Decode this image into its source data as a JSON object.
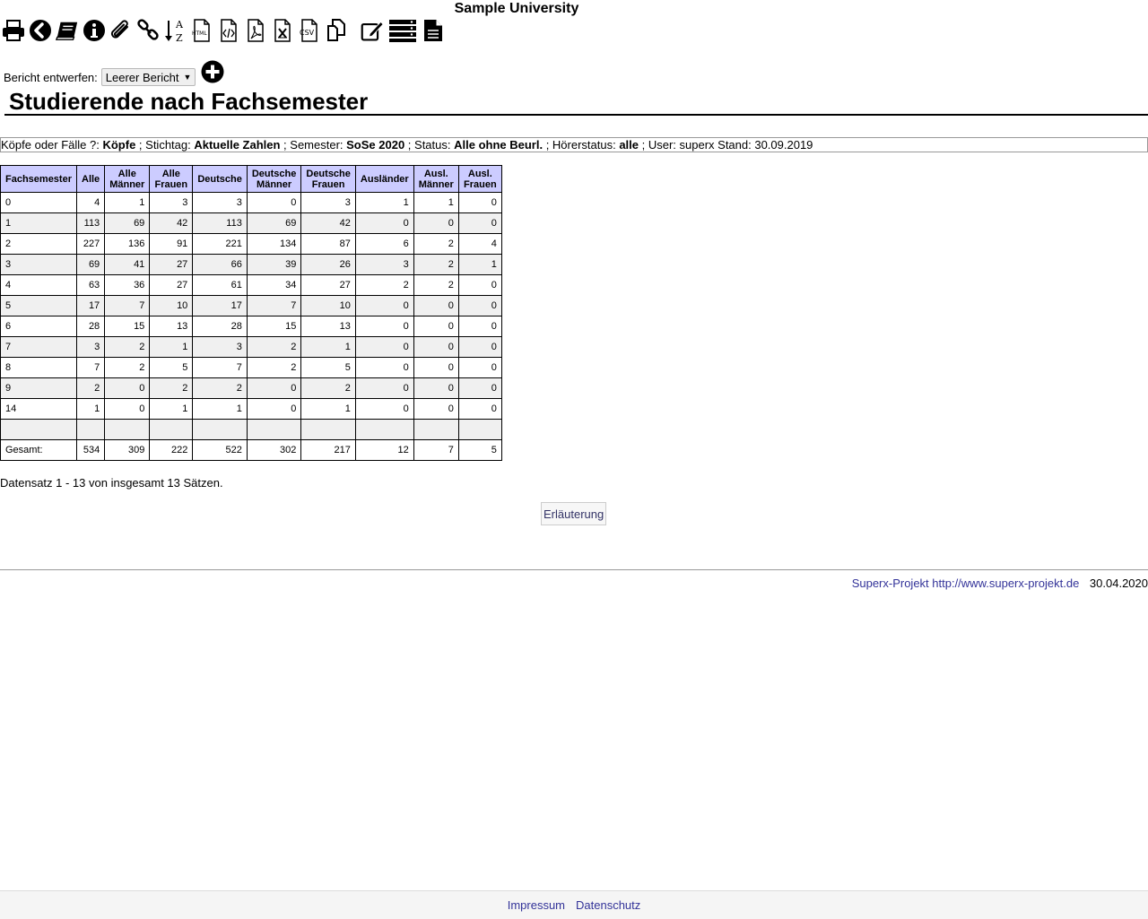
{
  "header": {
    "university": "Sample University"
  },
  "toolbar": {
    "icons": [
      "print-icon",
      "back-icon",
      "book-icon",
      "info-icon",
      "paperclip-icon",
      "link-icon",
      "sort-az-icon",
      "html-export-icon",
      "xml-export-icon",
      "pdf-export-icon",
      "excel-export-icon",
      "csv-export-icon",
      "copy-icon",
      "edit-icon",
      "list-icon",
      "document-icon"
    ],
    "html_label": "HTML",
    "csv_label": "CSV",
    "sort_top": "A",
    "sort_bottom": "Z"
  },
  "report": {
    "label": "Bericht entwerfen:",
    "selected": "Leerer Bericht",
    "arrow": "▼"
  },
  "page": {
    "title": "Studierende nach Fachsemester"
  },
  "filter": {
    "k1": "Köpfe oder Fälle ?: ",
    "v1": "Köpfe",
    "k2": " ; Stichtag: ",
    "v2": "Aktuelle Zahlen",
    "k3": " ; Semester: ",
    "v3": "SoSe 2020",
    "k4": " ; Status: ",
    "v4": "Alle ohne Beurl.",
    "k5": " ; Hörerstatus: ",
    "v5": "alle",
    "k6": " ; User: superx  Stand: 30.09.2019"
  },
  "table": {
    "headers": [
      [
        "Fachsemester"
      ],
      [
        "Alle"
      ],
      [
        "Alle",
        "Männer"
      ],
      [
        "Alle",
        "Frauen"
      ],
      [
        "Deutsche"
      ],
      [
        "Deutsche",
        "Männer"
      ],
      [
        "Deutsche",
        "Frauen"
      ],
      [
        "Ausländer"
      ],
      [
        "Ausl.",
        "Männer"
      ],
      [
        "Ausl.",
        "Frauen"
      ]
    ],
    "rows": [
      [
        "0",
        "4",
        "1",
        "3",
        "3",
        "0",
        "3",
        "1",
        "1",
        "0"
      ],
      [
        "1",
        "113",
        "69",
        "42",
        "113",
        "69",
        "42",
        "0",
        "0",
        "0"
      ],
      [
        "2",
        "227",
        "136",
        "91",
        "221",
        "134",
        "87",
        "6",
        "2",
        "4"
      ],
      [
        "3",
        "69",
        "41",
        "27",
        "66",
        "39",
        "26",
        "3",
        "2",
        "1"
      ],
      [
        "4",
        "63",
        "36",
        "27",
        "61",
        "34",
        "27",
        "2",
        "2",
        "0"
      ],
      [
        "5",
        "17",
        "7",
        "10",
        "17",
        "7",
        "10",
        "0",
        "0",
        "0"
      ],
      [
        "6",
        "28",
        "15",
        "13",
        "28",
        "15",
        "13",
        "0",
        "0",
        "0"
      ],
      [
        "7",
        "3",
        "2",
        "1",
        "3",
        "2",
        "1",
        "0",
        "0",
        "0"
      ],
      [
        "8",
        "7",
        "2",
        "5",
        "7",
        "2",
        "5",
        "0",
        "0",
        "0"
      ],
      [
        "9",
        "2",
        "0",
        "2",
        "2",
        "0",
        "2",
        "0",
        "0",
        "0"
      ],
      [
        "14",
        "1",
        "0",
        "1",
        "1",
        "0",
        "1",
        "0",
        "0",
        "0"
      ],
      [
        "",
        "",
        "",
        "",
        "",
        "",
        "",
        "",
        "",
        ""
      ],
      [
        "Gesamt:",
        "534",
        "309",
        "222",
        "522",
        "302",
        "217",
        "12",
        "7",
        "5"
      ]
    ]
  },
  "record_info": "Datensatz 1 - 13 von insgesamt 13 Sätzen.",
  "erlaeuterung": "Erläuterung",
  "footer": {
    "project_link": "Superx-Projekt http://www.superx-projekt.de",
    "date": "30.04.2020",
    "impressum": "Impressum",
    "datenschutz": "Datenschutz"
  }
}
